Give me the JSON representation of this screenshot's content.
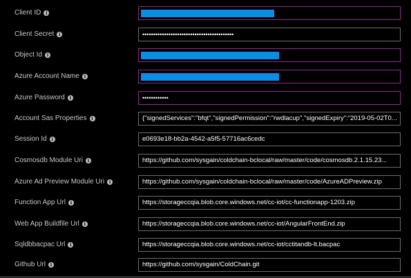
{
  "fields": [
    {
      "label": "Client ID",
      "value": "",
      "redacted": true,
      "active": true
    },
    {
      "label": "Client Secret",
      "value": "••••••••••••••••••••••••••••••••••••••••••",
      "redacted": false,
      "active": false
    },
    {
      "label": "Object Id",
      "value": "",
      "redacted": true,
      "active": true
    },
    {
      "label": "Azure Account Name",
      "value": "",
      "redacted": true,
      "active": true
    },
    {
      "label": "Azure Password",
      "value": "••••••••••••",
      "redacted": false,
      "active": true
    },
    {
      "label": "Account Sas Properties",
      "value": "{\"signedServices\":\"bfqt\",\"signedPermission\":\"rwdlacup\",\"signedExpiry\":\"2019-05-02T0...",
      "redacted": false,
      "active": false
    },
    {
      "label": "Session Id",
      "value": "e0693e18-bb2a-4542-a5f5-57716ac6cedc",
      "redacted": false,
      "active": false
    },
    {
      "label": "Cosmosdb Module Uri",
      "value": "https://github.com/sysgain/coldchain-bclocal/raw/master/code/cosmosdb.2.1.15.23...",
      "redacted": false,
      "active": false
    },
    {
      "label": "Azure Ad Preview Module Uri",
      "value": "https://github.com/sysgain/coldchain-bclocal/raw/master/code/AzureADPreview.zip",
      "redacted": false,
      "active": false
    },
    {
      "label": "Function App Url",
      "value": "https://storageccqia.blob.core.windows.net/cc-iot/cc-functionapp-1203.zip",
      "redacted": false,
      "active": false
    },
    {
      "label": "Web App Buildfile Url",
      "value": "https://storageccqia.blob.core.windows.net/cc-iot/AngularFrontEnd.zip",
      "redacted": false,
      "active": false
    },
    {
      "label": "Sqldbbacpac Url",
      "value": "https://storageccqia.blob.core.windows.net/cc-iot/cctitandb-lt.bacpac",
      "redacted": false,
      "active": false
    },
    {
      "label": "Github Url",
      "value": "https://github.com/sysgain/ColdChain.git",
      "redacted": false,
      "active": false
    }
  ],
  "redaction_fill": [
    0.51,
    0.53,
    0.53
  ],
  "colors": {
    "background": "#000000",
    "field_border": "#6e6e6e",
    "active_border": "#8f2d8f",
    "redact": "#0a8ee3",
    "label_text": "#c8c8c8",
    "value_text": "#ffffff"
  },
  "icons": {
    "info": "info-icon"
  }
}
